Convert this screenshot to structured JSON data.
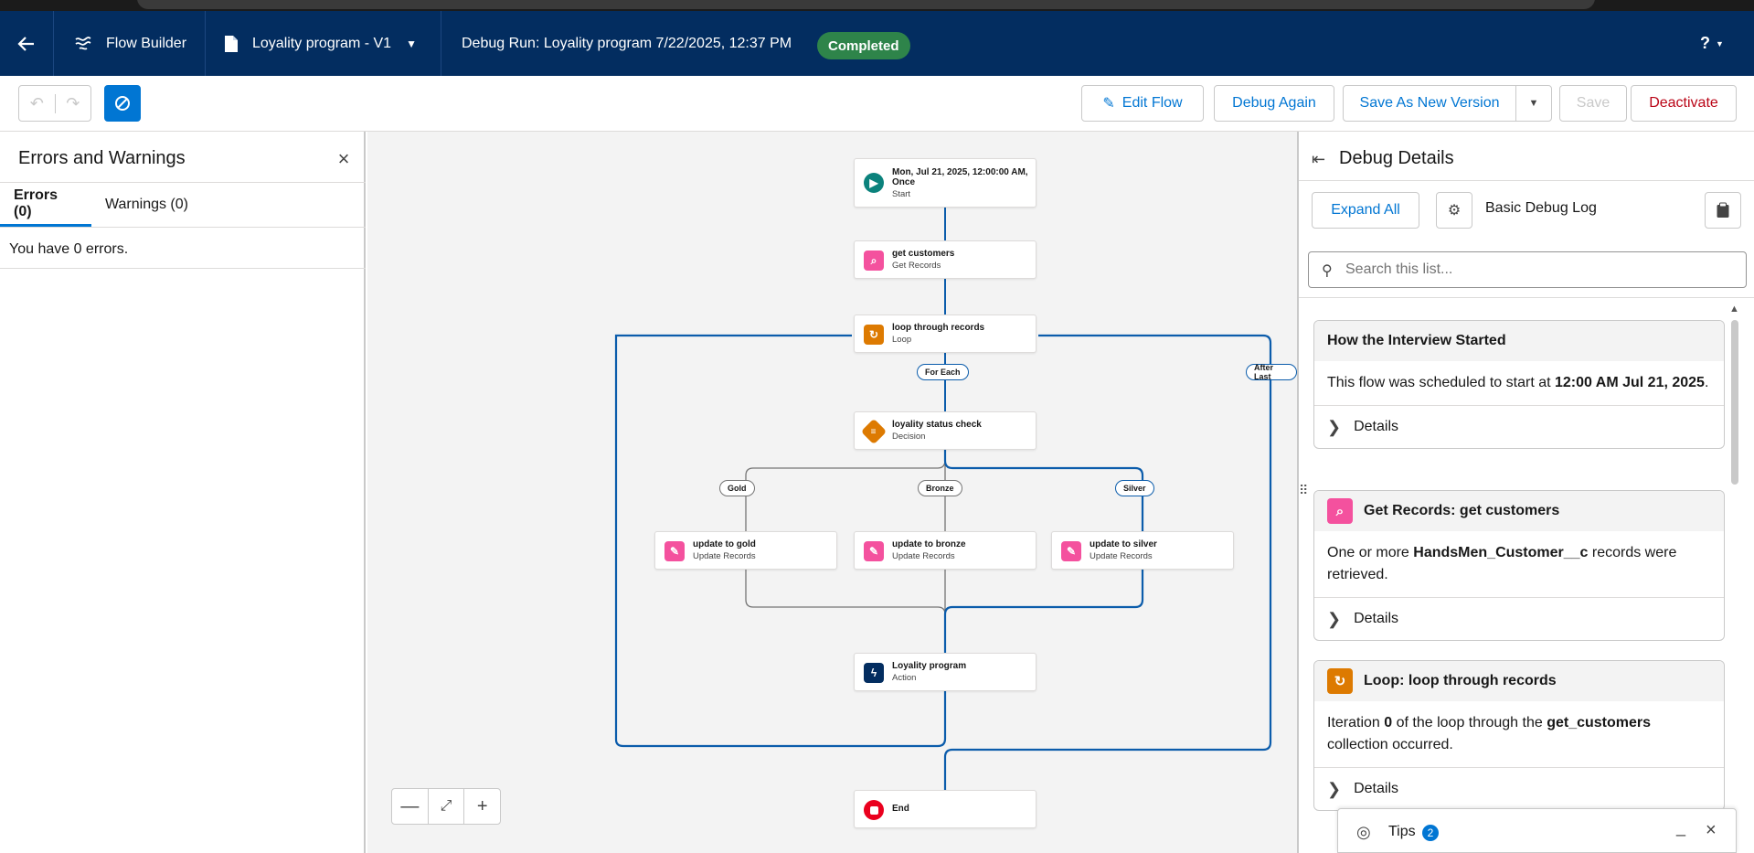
{
  "header": {
    "flow_builder_label": "Flow Builder",
    "flow_name": "Loyality program - V1",
    "debug_run_label": "Debug Run: Loyality program 7/22/2025, 12:37 PM",
    "status_badge": "Completed",
    "help_label": "?"
  },
  "toolbar": {
    "edit_flow": "Edit Flow",
    "debug_again": "Debug Again",
    "save_as_new_version": "Save As New Version",
    "save": "Save",
    "deactivate": "Deactivate"
  },
  "left_panel": {
    "title": "Errors and Warnings",
    "tabs": [
      {
        "label": "Errors (0)",
        "active": true
      },
      {
        "label": "Warnings (0)",
        "active": false
      }
    ],
    "message": "You have 0 errors."
  },
  "canvas": {
    "nodes": {
      "start": {
        "title": "Mon, Jul 21, 2025, 12:00:00 AM,",
        "title2": "Once",
        "subtitle": "Start"
      },
      "get_customers": {
        "title": "get customers",
        "subtitle": "Get Records"
      },
      "loop": {
        "title": "loop through records",
        "subtitle": "Loop"
      },
      "decision": {
        "title": "loyality status check",
        "subtitle": "Decision"
      },
      "update_gold": {
        "title": "update to gold",
        "subtitle": "Update Records"
      },
      "update_bronze": {
        "title": "update to bronze",
        "subtitle": "Update Records"
      },
      "update_silver": {
        "title": "update to silver",
        "subtitle": "Update Records"
      },
      "action": {
        "title": "Loyality program",
        "subtitle": "Action"
      },
      "end": {
        "title": "End"
      }
    },
    "pills": {
      "for_each": "For Each",
      "after_last": "After Last",
      "gold": "Gold",
      "bronze": "Bronze",
      "silver": "Silver"
    },
    "colors": {
      "active_path": "#0b5cab",
      "inactive_path": "#747474",
      "start_icon": "#0b827c",
      "records_icon": "#f4519e",
      "loop_icon": "#dd7a01",
      "action_icon": "#032d60",
      "end_icon": "#ea001e"
    }
  },
  "right_panel": {
    "title": "Debug Details",
    "expand_all": "Expand All",
    "log_label": "Basic Debug Log",
    "search_placeholder": "Search this list...",
    "cards": [
      {
        "title": "How the Interview Started",
        "body_prefix": "This flow was scheduled to start at ",
        "body_bold": "12:00 AM Jul 21, 2025",
        "body_suffix": ".",
        "details": "Details"
      },
      {
        "title": "Get Records: get customers",
        "body_prefix": "One or more ",
        "body_bold": "HandsMen_Customer__c",
        "body_suffix": " records were retrieved.",
        "details": "Details"
      },
      {
        "title": "Loop: loop through records",
        "body_prefix": "Iteration ",
        "body_bold": "0",
        "body_mid": " of the loop through the ",
        "body_bold2": "get_customers",
        "body_suffix": " collection occurred.",
        "details": "Details"
      }
    ]
  },
  "tips": {
    "label": "Tips",
    "count": "2"
  }
}
